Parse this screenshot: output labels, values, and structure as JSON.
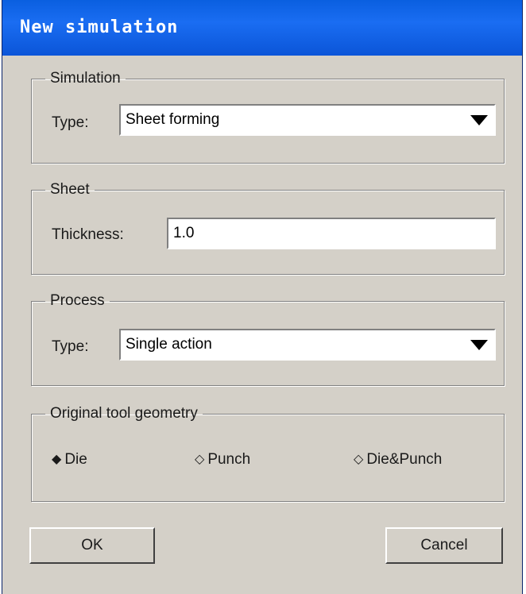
{
  "window": {
    "title": "New simulation"
  },
  "simulation": {
    "legend": "Simulation",
    "type_label": "Type:",
    "type_value": "Sheet forming"
  },
  "sheet": {
    "legend": "Sheet",
    "thickness_label": "Thickness:",
    "thickness_value": "1.0"
  },
  "process": {
    "legend": "Process",
    "type_label": "Type:",
    "type_value": "Single action"
  },
  "tool_geometry": {
    "legend": "Original tool geometry",
    "options": [
      {
        "label": "Die",
        "glyph": "◆",
        "selected": true
      },
      {
        "label": "Punch",
        "glyph": "◇",
        "selected": false
      },
      {
        "label": "Die&Punch",
        "glyph": "◇",
        "selected": false
      }
    ]
  },
  "buttons": {
    "ok": "OK",
    "cancel": "Cancel"
  }
}
